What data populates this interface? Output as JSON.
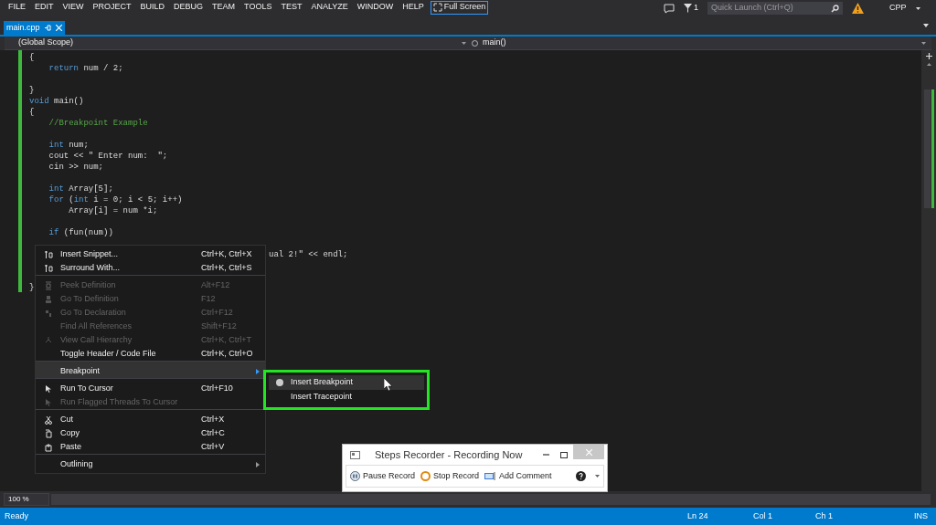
{
  "menu_bar": {
    "items": [
      "FILE",
      "EDIT",
      "VIEW",
      "PROJECT",
      "BUILD",
      "DEBUG",
      "TEAM",
      "TOOLS",
      "TEST",
      "ANALYZE",
      "WINDOW",
      "HELP"
    ],
    "full_screen": "Full Screen"
  },
  "title_bar": {
    "notification_count": "1",
    "quick_launch": {
      "placeholder": "Quick Launch (Ctrl+Q)"
    },
    "profile": "CPP"
  },
  "tabs": [
    {
      "label": "main.cpp",
      "selected": true
    }
  ],
  "navigation_bar": {
    "scope": "(Global Scope)",
    "member": "main()"
  },
  "code_lines": [
    {
      "kind": "normal",
      "tokens": [
        {
          "t": "{",
          "kind": "plain"
        }
      ]
    },
    {
      "kind": "normal",
      "tokens": [
        {
          "t": "    return",
          "kind": "keyword"
        },
        {
          "t": " num / 2;",
          "kind": "plain"
        }
      ]
    },
    {
      "kind": "blank"
    },
    {
      "kind": "normal",
      "tokens": [
        {
          "t": "}",
          "kind": "plain"
        }
      ]
    },
    {
      "kind": "normal",
      "tokens": [
        {
          "t": "void",
          "kind": "keyword"
        },
        {
          "t": " main()",
          "kind": "plain"
        }
      ]
    },
    {
      "kind": "normal",
      "tokens": [
        {
          "t": "{",
          "kind": "plain"
        }
      ]
    },
    {
      "kind": "normal",
      "tokens": [
        {
          "t": "    //Breakpoint Example",
          "kind": "comment"
        }
      ]
    },
    {
      "kind": "blank"
    },
    {
      "kind": "normal",
      "tokens": [
        {
          "t": "    int",
          "kind": "keyword"
        },
        {
          "t": " num;",
          "kind": "plain"
        }
      ]
    },
    {
      "kind": "normal",
      "tokens": [
        {
          "t": "    cout << \" Enter num:  \";",
          "kind": "plain"
        }
      ]
    },
    {
      "kind": "normal",
      "tokens": [
        {
          "t": "    cin >> num;",
          "kind": "plain"
        }
      ]
    },
    {
      "kind": "blank"
    },
    {
      "kind": "normal",
      "tokens": [
        {
          "t": "    int",
          "kind": "keyword"
        },
        {
          "t": " Array[5];",
          "kind": "plain"
        }
      ]
    },
    {
      "kind": "normal",
      "tokens": [
        {
          "t": "    for",
          "kind": "keyword"
        },
        {
          "t": " (",
          "kind": "plain"
        },
        {
          "t": "int",
          "kind": "keyword"
        },
        {
          "t": " i = 0; i < 5; i++)",
          "kind": "plain"
        }
      ]
    },
    {
      "kind": "normal",
      "tokens": [
        {
          "t": "        Array[i] = num *i;",
          "kind": "plain"
        }
      ]
    },
    {
      "kind": "blank"
    },
    {
      "kind": "normal",
      "tokens": [
        {
          "t": "    if",
          "kind": "keyword"
        },
        {
          "t": " (fun(num))",
          "kind": "plain"
        }
      ]
    },
    {
      "kind": "blank"
    },
    {
      "kind": "partial",
      "tokens": [
        {
          "t": "ual 2!\" << endl;",
          "kind": "plain"
        }
      ]
    },
    {
      "kind": "blank"
    },
    {
      "kind": "blank"
    },
    {
      "kind": "normal",
      "tokens": [
        {
          "t": "}",
          "kind": "plain"
        }
      ]
    }
  ],
  "context_menu": [
    {
      "label": "Insert Snippet...",
      "shortcut": "Ctrl+K, Ctrl+X",
      "disabled": false,
      "selected": false,
      "submenu": false,
      "separator_before": false
    },
    {
      "label": "Surround With...",
      "shortcut": "Ctrl+K, Ctrl+S",
      "disabled": false,
      "selected": false,
      "submenu": false,
      "separator_before": false
    },
    {
      "label": "Peek Definition",
      "shortcut": "Alt+F12",
      "disabled": true,
      "selected": false,
      "submenu": false,
      "separator_before": true
    },
    {
      "label": "Go To Definition",
      "shortcut": "F12",
      "disabled": true,
      "selected": false,
      "submenu": false,
      "separator_before": false
    },
    {
      "label": "Go To Declaration",
      "shortcut": "Ctrl+F12",
      "disabled": true,
      "selected": false,
      "submenu": false,
      "separator_before": false
    },
    {
      "label": "Find All References",
      "shortcut": "Shift+F12",
      "disabled": true,
      "selected": false,
      "submenu": false,
      "separator_before": false
    },
    {
      "label": "View Call Hierarchy",
      "shortcut": "Ctrl+K, Ctrl+T",
      "disabled": true,
      "selected": false,
      "submenu": false,
      "separator_before": false
    },
    {
      "label": "Toggle Header / Code File",
      "shortcut": "Ctrl+K, Ctrl+O",
      "disabled": false,
      "selected": false,
      "submenu": false,
      "separator_before": false
    },
    {
      "label": "Breakpoint",
      "disabled": false,
      "selected": true,
      "submenu": true,
      "separator_before": true
    },
    {
      "label": "Run To Cursor",
      "shortcut": "Ctrl+F10",
      "disabled": false,
      "selected": false,
      "submenu": false,
      "separator_before": true
    },
    {
      "label": "Run Flagged Threads To Cursor",
      "disabled": true,
      "selected": false,
      "submenu": false,
      "separator_before": false
    },
    {
      "label": "Cut",
      "shortcut": "Ctrl+X",
      "disabled": false,
      "selected": false,
      "submenu": false,
      "separator_before": true
    },
    {
      "label": "Copy",
      "shortcut": "Ctrl+C",
      "disabled": false,
      "selected": false,
      "submenu": false,
      "separator_before": false
    },
    {
      "label": "Paste",
      "shortcut": "Ctrl+V",
      "disabled": false,
      "selected": false,
      "submenu": false,
      "separator_before": false
    },
    {
      "label": "Outlining",
      "disabled": false,
      "selected": false,
      "submenu": true,
      "separator_before": true
    }
  ],
  "submenu": [
    {
      "label": "Insert Breakpoint",
      "selected": true
    },
    {
      "label": "Insert Tracepoint",
      "selected": false
    }
  ],
  "steps_recorder": {
    "title": "Steps Recorder - Recording Now",
    "buttons": [
      "Pause Record",
      "Stop Record",
      "Add Comment"
    ]
  },
  "zoom_level": "100 %",
  "status_bar": {
    "message": "Ready",
    "line": "Ln 24",
    "column": "Col 1",
    "char": "Ch 1",
    "mode": "INS"
  }
}
